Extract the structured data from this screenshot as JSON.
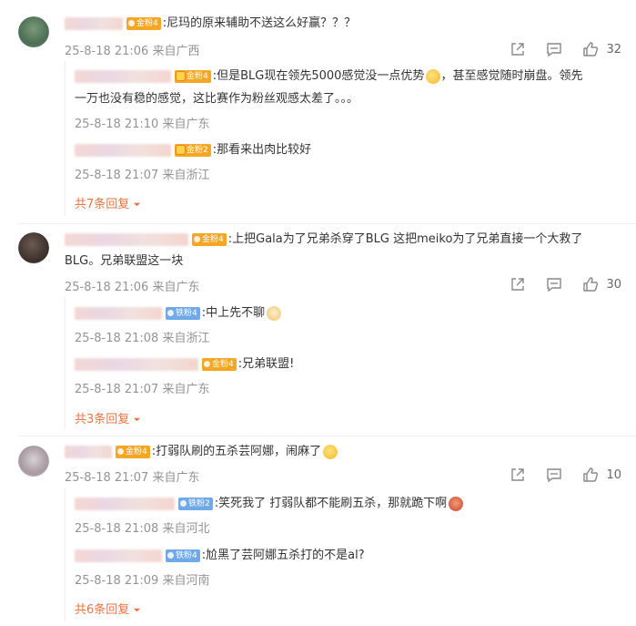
{
  "comments": [
    {
      "badge": "金粉4",
      "text": ":尼玛的原来辅助不送这么好赢？？？",
      "time": "25-8-18 21:06",
      "location": "来自广西",
      "likes": "32",
      "replies": [
        {
          "badge": "金粉4",
          "text_line1": ":但是BLG现在领先5000感觉没一点优势",
          "text_line1b": "，甚至感觉随时崩盘。领先",
          "text_line2": "一万也没有稳的感觉，这比赛作为粉丝观感太差了。。。",
          "time": "25-8-18 21:10",
          "location": "来自广东"
        },
        {
          "badge": "金粉2",
          "text_line1": ":那看来出肉比较好",
          "time": "25-8-18 21:07",
          "location": "来自浙江"
        }
      ],
      "more": "共7条回复"
    },
    {
      "badge": "金粉4",
      "text_line1": ":上把Gala为了兄弟杀穿了BLG 这把meiko为了兄弟直接一个大救了",
      "text_line2": "BLG。兄弟联盟这一块",
      "time": "25-8-18 21:06",
      "location": "来自广东",
      "likes": "30",
      "replies": [
        {
          "badge": "铁粉4",
          "text_line1": ":中上先不聊",
          "time": "25-8-18 21:08",
          "location": "来自浙江"
        },
        {
          "badge": "金粉4",
          "text_line1": ":兄弟联盟!",
          "time": "25-8-18 21:07",
          "location": "来自广东"
        }
      ],
      "more": "共3条回复"
    },
    {
      "badge": "金粉4",
      "text": ":打弱队刷的五杀芸阿娜，闹麻了",
      "time": "25-8-18 21:07",
      "location": "来自广东",
      "likes": "10",
      "replies": [
        {
          "badge": "铁粉2",
          "text_line1": ":笑死我了 打弱队都不能刷五杀，那就跪下啊",
          "time": "25-8-18 21:08",
          "location": "来自河北"
        },
        {
          "badge": "铁粉4",
          "text_line1": ":尬黑了芸阿娜五杀打的不是al?",
          "time": "25-8-18 21:09",
          "location": "来自河南"
        }
      ],
      "more": "共6条回复"
    }
  ],
  "icons": {
    "share": "share-icon",
    "comment": "comment-icon",
    "like": "like-icon",
    "chevron": "chevron-down-icon"
  },
  "colors": {
    "more_link": "#eb7340",
    "meta": "#939393",
    "gold_badge": "#f5a623",
    "iron_badge": "#6fa9e8"
  }
}
